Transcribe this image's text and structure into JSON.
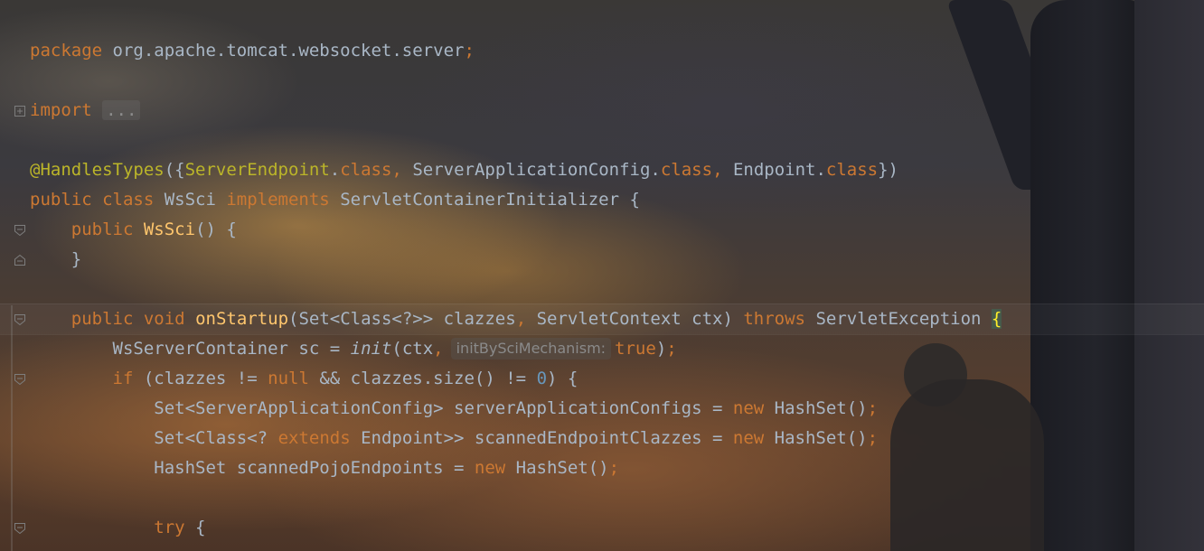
{
  "editor": {
    "lines": [
      {
        "indent": "",
        "tokens": [
          {
            "t": "package",
            "c": "kw"
          },
          {
            "t": " org.apache.tomcat.websocket.server",
            "c": "id"
          },
          {
            "t": ";",
            "c": "kw"
          }
        ],
        "fold": ""
      },
      {
        "indent": "",
        "tokens": [],
        "fold": ""
      },
      {
        "indent": "",
        "tokens": [
          {
            "t": "import",
            "c": "kw"
          },
          {
            "t": " ",
            "c": "id"
          },
          {
            "t": "...",
            "c": "ellipsis"
          }
        ],
        "fold": "plus"
      },
      {
        "indent": "",
        "tokens": [],
        "fold": ""
      },
      {
        "indent": "",
        "tokens": [
          {
            "t": "@HandlesTypes",
            "c": "ann"
          },
          {
            "t": "({",
            "c": "id"
          },
          {
            "t": "ServerEndpoint",
            "c": "ann"
          },
          {
            "t": ".",
            "c": "id"
          },
          {
            "t": "class",
            "c": "kw"
          },
          {
            "t": ", ",
            "c": "kw"
          },
          {
            "t": "ServerApplicationConfig.",
            "c": "id"
          },
          {
            "t": "class",
            "c": "kw"
          },
          {
            "t": ", ",
            "c": "kw"
          },
          {
            "t": "Endpoint.",
            "c": "id"
          },
          {
            "t": "class",
            "c": "kw"
          },
          {
            "t": "})",
            "c": "id"
          }
        ],
        "fold": ""
      },
      {
        "indent": "",
        "tokens": [
          {
            "t": "public class",
            "c": "kw"
          },
          {
            "t": " WsSci ",
            "c": "id"
          },
          {
            "t": "implements",
            "c": "kw"
          },
          {
            "t": " ServletContainerInitializer {",
            "c": "id"
          }
        ],
        "fold": ""
      },
      {
        "indent": "    ",
        "tokens": [
          {
            "t": "public",
            "c": "kw"
          },
          {
            "t": " ",
            "c": "id"
          },
          {
            "t": "WsSci",
            "c": "fn"
          },
          {
            "t": "() {",
            "c": "id"
          }
        ],
        "fold": "open"
      },
      {
        "indent": "    ",
        "tokens": [
          {
            "t": "}",
            "c": "id"
          }
        ],
        "fold": "close"
      },
      {
        "indent": "",
        "tokens": [],
        "fold": ""
      },
      {
        "indent": "    ",
        "tokens": [
          {
            "t": "public void",
            "c": "kw"
          },
          {
            "t": " ",
            "c": "id"
          },
          {
            "t": "onStartup",
            "c": "fn"
          },
          {
            "t": "(Set<Class<?>> clazzes",
            "c": "id"
          },
          {
            "t": ", ",
            "c": "kw"
          },
          {
            "t": "ServletContext ctx) ",
            "c": "id"
          },
          {
            "t": "throws",
            "c": "kw"
          },
          {
            "t": " ServletException ",
            "c": "id"
          },
          {
            "t": "{",
            "c": "brace-hl"
          }
        ],
        "fold": "open"
      },
      {
        "indent": "        ",
        "tokens": [
          {
            "t": "WsServerContainer sc = ",
            "c": "id"
          },
          {
            "t": "init",
            "c": "it"
          },
          {
            "t": "(ctx",
            "c": "id"
          },
          {
            "t": ",",
            "c": "kw"
          },
          {
            "t": "initBySciMechanism:",
            "c": "hint"
          },
          {
            "t": "true",
            "c": "kw"
          },
          {
            "t": ")",
            "c": "id"
          },
          {
            "t": ";",
            "c": "kw"
          }
        ],
        "fold": ""
      },
      {
        "indent": "        ",
        "tokens": [
          {
            "t": "if",
            "c": "kw"
          },
          {
            "t": " (clazzes != ",
            "c": "id"
          },
          {
            "t": "null",
            "c": "kw"
          },
          {
            "t": " && clazzes.size() != ",
            "c": "id"
          },
          {
            "t": "0",
            "c": "num"
          },
          {
            "t": ") {",
            "c": "id"
          }
        ],
        "fold": "open"
      },
      {
        "indent": "            ",
        "tokens": [
          {
            "t": "Set<ServerApplicationConfig> serverApplicationConfigs = ",
            "c": "id"
          },
          {
            "t": "new",
            "c": "kw"
          },
          {
            "t": " HashSet()",
            "c": "id"
          },
          {
            "t": ";",
            "c": "kw"
          }
        ],
        "fold": ""
      },
      {
        "indent": "            ",
        "tokens": [
          {
            "t": "Set<Class<? ",
            "c": "id"
          },
          {
            "t": "extends",
            "c": "kw"
          },
          {
            "t": " Endpoint>> scannedEndpointClazzes = ",
            "c": "id"
          },
          {
            "t": "new",
            "c": "kw"
          },
          {
            "t": " HashSet()",
            "c": "id"
          },
          {
            "t": ";",
            "c": "kw"
          }
        ],
        "fold": ""
      },
      {
        "indent": "            ",
        "tokens": [
          {
            "t": "HashSet scannedPojoEndpoints = ",
            "c": "id"
          },
          {
            "t": "new",
            "c": "kw"
          },
          {
            "t": " HashSet()",
            "c": "id"
          },
          {
            "t": ";",
            "c": "kw"
          }
        ],
        "fold": ""
      },
      {
        "indent": "",
        "tokens": [],
        "fold": ""
      },
      {
        "indent": "            ",
        "tokens": [
          {
            "t": "try",
            "c": "kw"
          },
          {
            "t": " {",
            "c": "id"
          }
        ],
        "fold": "open"
      }
    ]
  },
  "colors": {
    "keyword": "#cc7832",
    "annotation": "#bbb529",
    "method": "#ffc66d",
    "number": "#6897bb",
    "identifier": "#a9b7c6"
  },
  "icons": [
    "fold-plus-icon",
    "fold-open-icon",
    "fold-close-icon"
  ]
}
